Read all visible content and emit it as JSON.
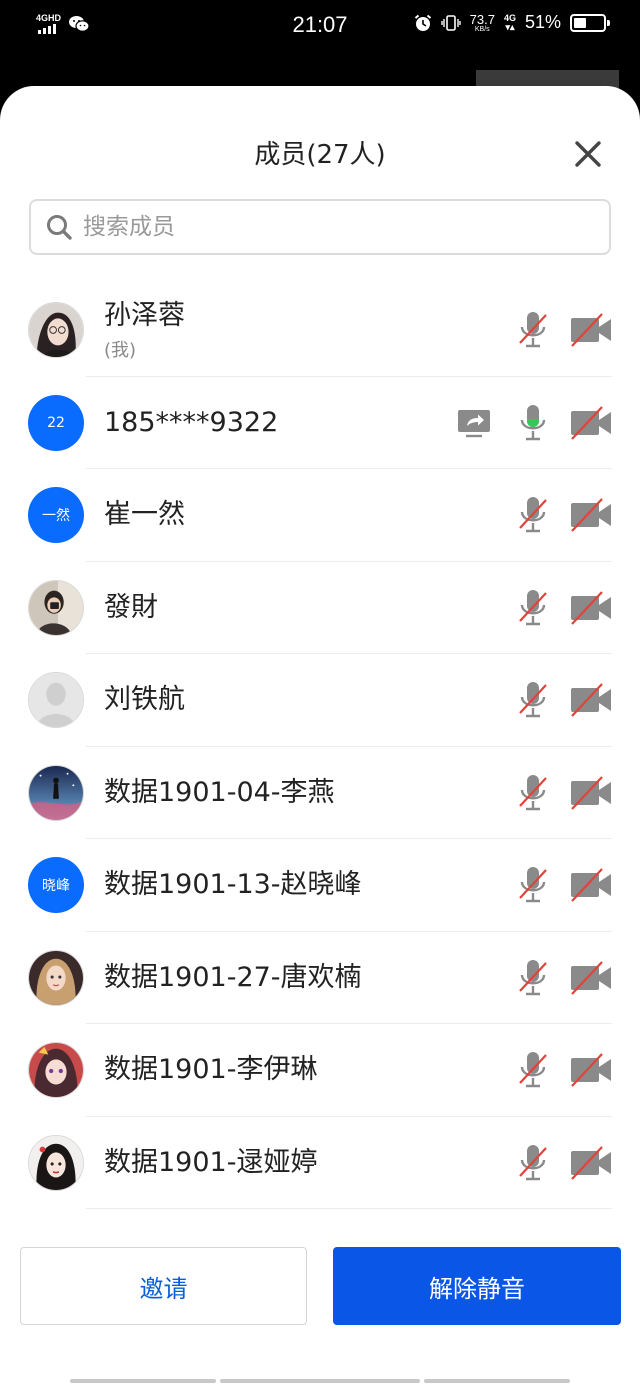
{
  "status_bar": {
    "network_tag": "4GHD",
    "time": "21:07",
    "speed_value": "73.7",
    "speed_unit": "KB/s",
    "network_right": "4G",
    "battery_pct": "51%",
    "battery_level": 0.51
  },
  "sheet": {
    "title": "成员(27人)",
    "search_placeholder": "搜索成员"
  },
  "members": [
    {
      "name": "孙泽蓉",
      "sub": "(我)",
      "avatar": "photo-glasses-girl",
      "mic": "muted",
      "camera": "off"
    },
    {
      "name": "185****9322",
      "avatar_text": "22",
      "avatar": "blue",
      "mic": "active",
      "camera": "off",
      "screen_share": true
    },
    {
      "name": "崔一然",
      "avatar_text": "一然",
      "avatar": "blue",
      "mic": "muted",
      "camera": "off"
    },
    {
      "name": "發財",
      "avatar": "photo-selfie",
      "mic": "muted",
      "camera": "off"
    },
    {
      "name": "刘铁航",
      "avatar": "default-person",
      "mic": "muted",
      "camera": "off"
    },
    {
      "name": "数据1901-04-李燕",
      "avatar": "photo-night-sky",
      "mic": "muted",
      "camera": "off"
    },
    {
      "name": "数据1901-13-赵晓峰",
      "avatar_text": "晓峰",
      "avatar": "blue",
      "mic": "muted",
      "camera": "off"
    },
    {
      "name": "数据1901-27-唐欢楠",
      "avatar": "photo-anime-girl",
      "mic": "muted",
      "camera": "off"
    },
    {
      "name": "数据1901-李伊琳",
      "avatar": "photo-anime-red",
      "mic": "muted",
      "camera": "off"
    },
    {
      "name": "数据1901-逯娅婷",
      "avatar": "photo-girl-portrait",
      "mic": "muted",
      "camera": "off"
    }
  ],
  "buttons": {
    "invite": "邀请",
    "unmute_all": "解除静音"
  },
  "colors": {
    "accent_blue": "#0a56e6",
    "avatar_blue": "#0a6cff",
    "mute_slash": "#e0433a",
    "mic_active": "#34c759",
    "icon_gray": "#8a8a8a"
  }
}
